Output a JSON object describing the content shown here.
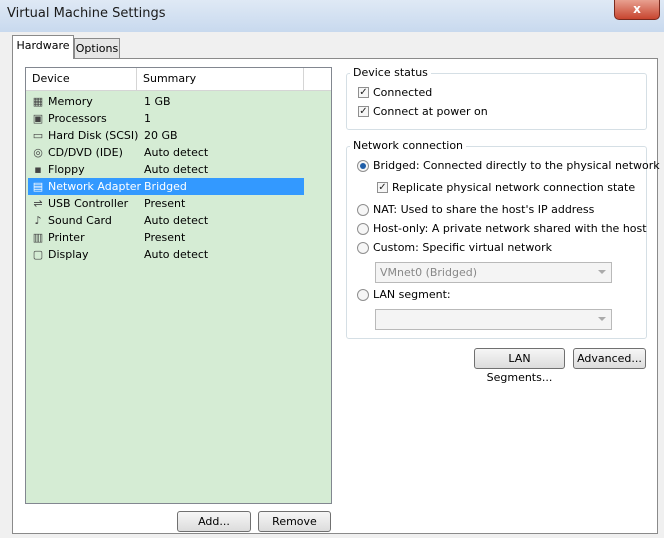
{
  "window": {
    "title": "Virtual Machine Settings",
    "close": "x"
  },
  "tabs": [
    {
      "label": "Hardware"
    },
    {
      "label": "Options"
    }
  ],
  "device_list": {
    "headers": {
      "device": "Device",
      "summary": "Summary"
    },
    "rows": [
      {
        "name": "Memory",
        "summary": "1 GB",
        "icon": "memory-icon",
        "glyph": "▦"
      },
      {
        "name": "Processors",
        "summary": "1",
        "icon": "processor-icon",
        "glyph": "▣"
      },
      {
        "name": "Hard Disk (SCSI)",
        "summary": "20 GB",
        "icon": "hard-disk-icon",
        "glyph": "▭"
      },
      {
        "name": "CD/DVD (IDE)",
        "summary": "Auto detect",
        "icon": "cd-icon",
        "glyph": "◎"
      },
      {
        "name": "Floppy",
        "summary": "Auto detect",
        "icon": "floppy-icon",
        "glyph": "▪"
      },
      {
        "name": "Network Adapter",
        "summary": "Bridged",
        "icon": "network-adapter-icon",
        "glyph": "▤"
      },
      {
        "name": "USB Controller",
        "summary": "Present",
        "icon": "usb-icon",
        "glyph": "⇌"
      },
      {
        "name": "Sound Card",
        "summary": "Auto detect",
        "icon": "sound-icon",
        "glyph": "♪"
      },
      {
        "name": "Printer",
        "summary": "Present",
        "icon": "printer-icon",
        "glyph": "▥"
      },
      {
        "name": "Display",
        "summary": "Auto detect",
        "icon": "display-icon",
        "glyph": "▢"
      }
    ],
    "selected_index": 5
  },
  "buttons": {
    "add": "Add...",
    "remove": "Remove",
    "lan_segments": "LAN Segments...",
    "advanced": "Advanced..."
  },
  "device_status": {
    "title": "Device status",
    "connected": {
      "label": "Connected",
      "checked": true
    },
    "connect_at_power_on": {
      "label": "Connect at power on",
      "checked": true
    }
  },
  "network_connection": {
    "title": "Network connection",
    "bridged": {
      "label": "Bridged: Connected directly to the physical network",
      "selected": true
    },
    "replicate": {
      "label": "Replicate physical network connection state",
      "checked": true
    },
    "nat": {
      "label": "NAT: Used to share the host's IP address",
      "selected": false
    },
    "host_only": {
      "label": "Host-only: A private network shared with the host",
      "selected": false
    },
    "custom": {
      "label": "Custom: Specific virtual network",
      "selected": false
    },
    "custom_dropdown": {
      "value": "VMnet0 (Bridged)"
    },
    "lan_segment": {
      "label": "LAN segment:",
      "selected": false
    },
    "lan_dropdown": {
      "value": ""
    }
  },
  "check_glyph": "✓"
}
